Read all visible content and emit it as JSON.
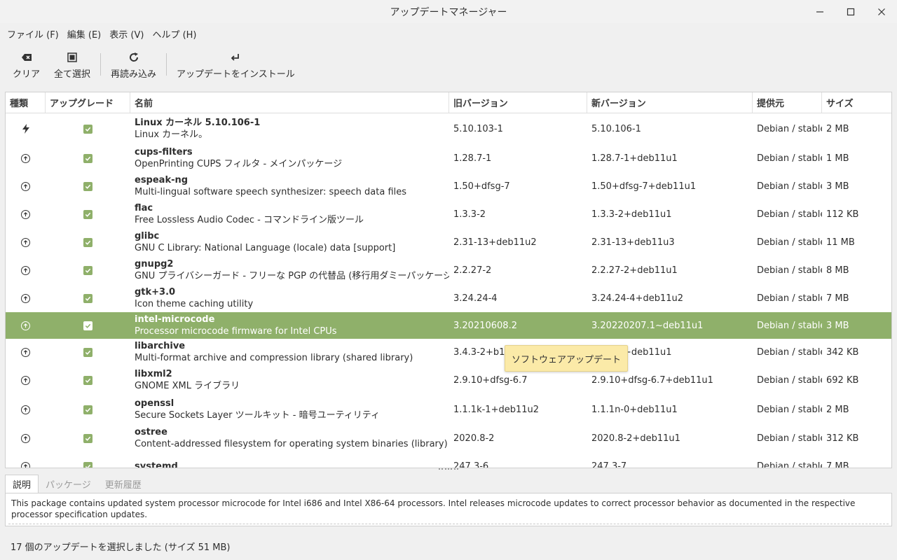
{
  "window": {
    "title": "アップデートマネージャー"
  },
  "menu": [
    {
      "label": "ファイル (F)"
    },
    {
      "label": "編集 (E)"
    },
    {
      "label": "表示 (V)"
    },
    {
      "label": "ヘルプ (H)"
    }
  ],
  "toolbar": {
    "clear_label": "クリア",
    "select_all_label": "全て選択",
    "reload_label": "再読み込み",
    "install_label": "アップデートをインストール"
  },
  "columns": {
    "type": "種類",
    "upgrade": "アップグレード",
    "name": "名前",
    "old": "旧バージョン",
    "new": "新バージョン",
    "origin": "提供元",
    "size": "サイズ"
  },
  "rows": [
    {
      "type": "kernel",
      "name": "Linux カーネル 5.10.106-1",
      "desc": "Linux カーネル。",
      "old": "5.10.103-1",
      "new": "5.10.106-1",
      "origin": "Debian / stable",
      "size": "2 MB"
    },
    {
      "type": "upgrade",
      "name": "cups-filters",
      "desc": "OpenPrinting CUPS フィルタ - メインパッケージ",
      "old": "1.28.7-1",
      "new": "1.28.7-1+deb11u1",
      "origin": "Debian / stable",
      "size": "1 MB"
    },
    {
      "type": "upgrade",
      "name": "espeak-ng",
      "desc": "Multi-lingual software speech synthesizer: speech data files",
      "old": "1.50+dfsg-7",
      "new": "1.50+dfsg-7+deb11u1",
      "origin": "Debian / stable",
      "size": "3 MB"
    },
    {
      "type": "upgrade",
      "name": "flac",
      "desc": "Free Lossless Audio Codec - コマンドライン版ツール",
      "old": "1.3.3-2",
      "new": "1.3.3-2+deb11u1",
      "origin": "Debian / stable",
      "size": "112 KB"
    },
    {
      "type": "upgrade",
      "name": "glibc",
      "desc": "GNU C Library: National Language (locale) data [support]",
      "old": "2.31-13+deb11u2",
      "new": "2.31-13+deb11u3",
      "origin": "Debian / stable",
      "size": "11 MB"
    },
    {
      "type": "upgrade",
      "name": "gnupg2",
      "desc": "GNU プライバシーガード - フリーな PGP の代替品 (移行用ダミーパッケージ)",
      "old": "2.2.27-2",
      "new": "2.2.27-2+deb11u1",
      "origin": "Debian / stable",
      "size": "8 MB"
    },
    {
      "type": "upgrade",
      "name": "gtk+3.0",
      "desc": "Icon theme caching utility",
      "old": "3.24.24-4",
      "new": "3.24.24-4+deb11u2",
      "origin": "Debian / stable",
      "size": "7 MB"
    },
    {
      "type": "upgrade",
      "name": "intel-microcode",
      "desc": "Processor microcode firmware for Intel CPUs",
      "old": "3.20210608.2",
      "new": "3.20220207.1~deb11u1",
      "origin": "Debian / stable",
      "size": "3 MB",
      "selected": true
    },
    {
      "type": "upgrade",
      "name": "libarchive",
      "desc": "Multi-format archive and compression library (shared library)",
      "old": "3.4.3-2+b1",
      "new": "3.4.3-2+deb11u1",
      "origin": "Debian / stable",
      "size": "342 KB"
    },
    {
      "type": "upgrade",
      "name": "libxml2",
      "desc": "GNOME XML ライブラリ",
      "old": "2.9.10+dfsg-6.7",
      "new": "2.9.10+dfsg-6.7+deb11u1",
      "origin": "Debian / stable",
      "size": "692 KB"
    },
    {
      "type": "upgrade",
      "name": "openssl",
      "desc": "Secure Sockets Layer ツールキット - 暗号ユーティリティ",
      "old": "1.1.1k-1+deb11u2",
      "new": "1.1.1n-0+deb11u1",
      "origin": "Debian / stable",
      "size": "2 MB"
    },
    {
      "type": "upgrade",
      "name": "ostree",
      "desc": "Content-addressed filesystem for operating system binaries (library)",
      "old": "2020.8-2",
      "new": "2020.8-2+deb11u1",
      "origin": "Debian / stable",
      "size": "312 KB"
    },
    {
      "type": "upgrade",
      "name": "systemd",
      "desc": "",
      "old": "247.3-6",
      "new": "247.3-7",
      "origin": "Debian / stable",
      "size": "7 MB"
    }
  ],
  "tooltip": "ソフトウェアアップデート",
  "tabs": [
    "説明",
    "パッケージ",
    "更新履歴"
  ],
  "description": "This package contains updated system processor microcode for Intel i686 and Intel X86-64 processors.  Intel releases microcode updates to correct processor behavior as documented in the respective processor specification updates.",
  "status": "17 個のアップデートを選択しました (サイズ 51 MB)",
  "colors": {
    "accent": "#8fb06a",
    "tooltip_bg": "#fbeaa8"
  }
}
